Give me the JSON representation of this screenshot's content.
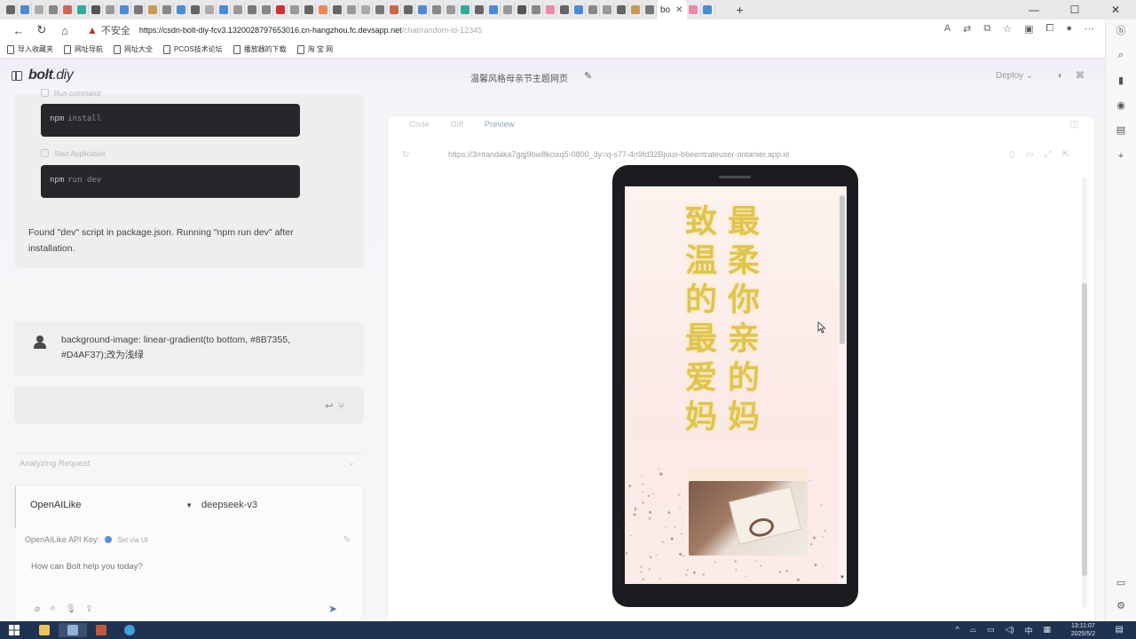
{
  "browser": {
    "active_tab_label": "bo",
    "url_warning": "不安全",
    "url": "https://csdn-bolt-diy-fcv3.132002879765301​6.cn-hangzhou.fc.devsapp.net",
    "url_dim": "/chat/random-id-12345",
    "bookmarks": [
      "导入收藏夹",
      "网址导航",
      "网址大全",
      "PCOS技术论坛",
      "播放器的下载",
      "淘 宝 网"
    ]
  },
  "app": {
    "logo_main": "bolt",
    "logo_suffix": ".diy",
    "chat_title": "温馨风格母亲节主题网页",
    "deploy_label": "Deploy"
  },
  "chat": {
    "step1_label": "Run command",
    "cmd1_prompt": "npm",
    "cmd1_text": "install",
    "step2_label": "Start Application",
    "cmd2_prompt": "npm",
    "cmd2_text": "run dev",
    "found_text": "Found \"dev\" script in package.json. Running \"npm run dev\" after installation.",
    "user_message": "background-image: linear-gradient(to bottom, #8B7355, #D4AF37);改为浅绿",
    "analyzing_label": "Analyzing Request"
  },
  "composer": {
    "provider": "OpenAILike",
    "model": "deepseek-v3",
    "api_key_label": "OpenAILike API Key:",
    "api_key_status": "Set via UI",
    "prompt_placeholder": "How can Bolt help you today?"
  },
  "workbench": {
    "tabs": [
      "Code",
      "Diff",
      "Preview"
    ],
    "preview_url": "https://3mtandaka7gqj9bw8kcixq5-0800_3y=q-s77-4n9fd32Bjuux-b6eentrateuser-ontanier.app.io"
  },
  "preview": {
    "col1": "最柔你亲的妈",
    "col2": "致温的最爱妈"
  },
  "taskbar": {
    "time": "13:11:07",
    "date": "2025/5/2",
    "ime": "中"
  },
  "colors": {
    "accent_gold": "#D4AF37",
    "gradient_start": "#8B7355"
  }
}
